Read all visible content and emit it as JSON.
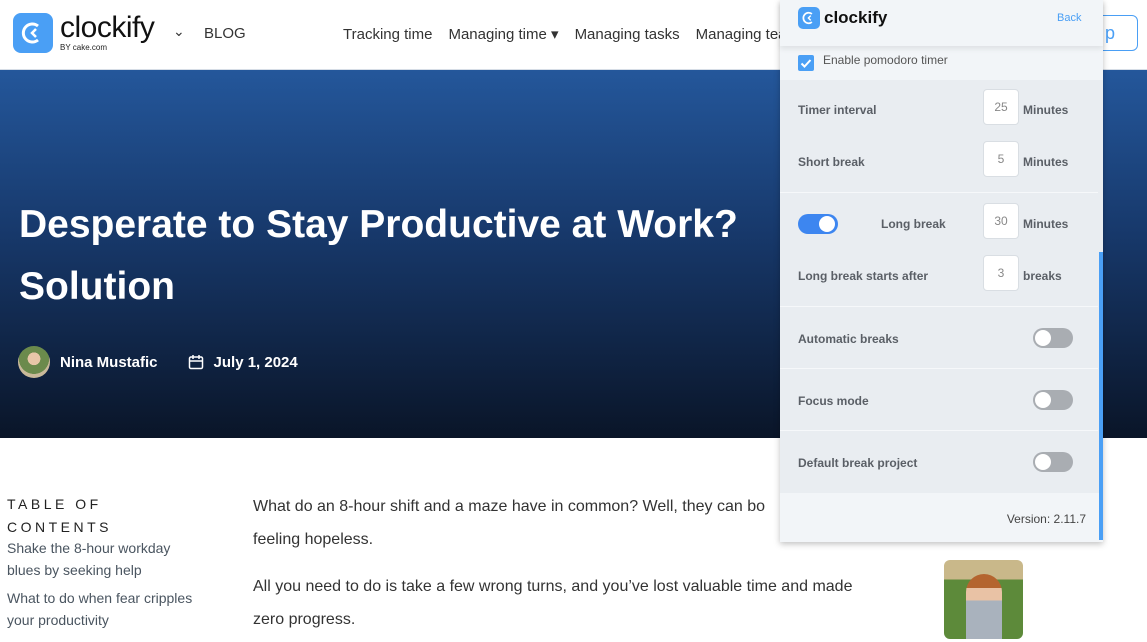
{
  "nav": {
    "brand": "clockify",
    "brand_sub": "BY cake.com",
    "blog": "BLOG",
    "menu": [
      "Tracking time",
      "Managing time ▾",
      "Managing tasks",
      "Managing tea"
    ],
    "cta_partial": "p"
  },
  "hero": {
    "title_line1": "Desperate to Stay Productive at Work?",
    "title_line2": "Solution",
    "author": "Nina Mustafic",
    "date": "July 1, 2024"
  },
  "toc": {
    "heading": "TABLE OF CONTENTS",
    "items": [
      "Shake the 8-hour workday blues by seeking help",
      "What to do when fear cripples your productivity"
    ]
  },
  "article": {
    "p1": "What do an 8-hour shift and a maze have in common? Well, they can bo",
    "p1b": "feeling hopeless.",
    "p2": "All you need to do is take a few wrong turns, and you’ve lost valuable time and made",
    "p2b": "zero progress."
  },
  "panel": {
    "brand": "clockify",
    "back": "Back",
    "enable_pomodoro": "Enable pomodoro timer",
    "enable_pomodoro_checked": true,
    "timer_interval": {
      "label": "Timer interval",
      "value": "25",
      "unit": "Minutes"
    },
    "short_break": {
      "label": "Short break",
      "value": "5",
      "unit": "Minutes"
    },
    "long_break": {
      "label": "Long break",
      "value": "30",
      "unit": "Minutes",
      "enabled": true
    },
    "long_break_after": {
      "label": "Long break starts after",
      "value": "3",
      "unit": "breaks"
    },
    "automatic_breaks": {
      "label": "Automatic breaks",
      "enabled": false
    },
    "focus_mode": {
      "label": "Focus mode",
      "enabled": false
    },
    "default_break_project": {
      "label": "Default break project",
      "enabled": false
    },
    "version": "Version: 2.11.7"
  },
  "colors": {
    "accent": "#4a9ff5",
    "toggle_on": "#3d86f0",
    "hero_top": "#24579b",
    "hero_bottom": "#0a1528"
  }
}
